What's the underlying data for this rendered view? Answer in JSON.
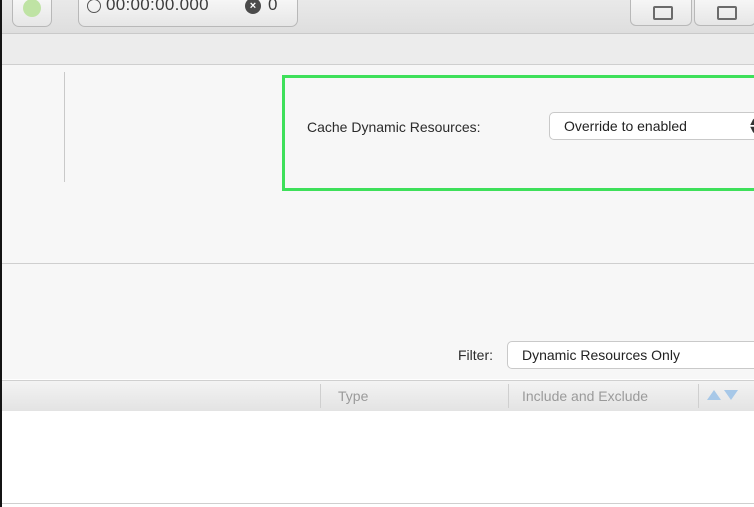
{
  "toolbar": {
    "timer": "00:00:00.000",
    "error_count": "0",
    "icons": [
      "clock-icon",
      "close-circle-icon",
      "window-icon",
      "monitor-icon"
    ]
  },
  "settings": {
    "cache_label": "Cache Dynamic Resources:",
    "cache_value": "Override to enabled"
  },
  "filter": {
    "label": "Filter:",
    "value": "Dynamic Resources Only"
  },
  "table": {
    "columns": [
      "Type",
      "Include and Exclude"
    ]
  },
  "colors": {
    "highlight": "#3ee05a",
    "sort_arrow": "#a7c8e8"
  }
}
